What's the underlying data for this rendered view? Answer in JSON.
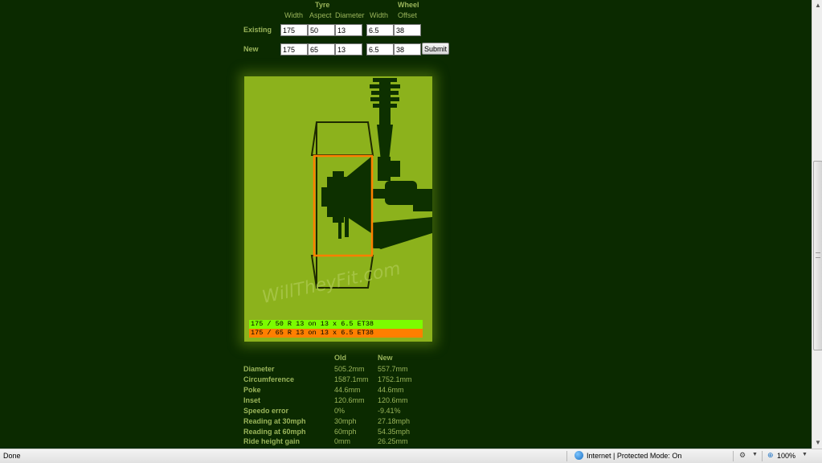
{
  "form": {
    "header_tyre": "Tyre",
    "header_wheel": "Wheel",
    "col_width": "Width",
    "col_aspect": "Aspect",
    "col_diameter": "Diameter",
    "col_wheel_width": "Width",
    "col_offset": "Offset",
    "existing_label": "Existing",
    "new_label": "New",
    "existing": {
      "width": "175",
      "aspect": "50",
      "diameter": "13",
      "wheel_width": "6.5",
      "offset": "38"
    },
    "new": {
      "width": "175",
      "aspect": "65",
      "diameter": "13",
      "wheel_width": "6.5",
      "offset": "38"
    },
    "submit_label": "Submit"
  },
  "diagram": {
    "watermark": "WillTheyFit.com",
    "existing_line": "175 / 50 R 13 on 13 x 6.5 ET38",
    "new_line": "175 / 65 R 13 on 13 x 6.5 ET38",
    "colors": {
      "existing": "#7cfc00",
      "new": "#ff7f00",
      "panel": "#8cb21c",
      "suspension": "#0d3000"
    }
  },
  "results": {
    "col_old": "Old",
    "col_new": "New",
    "rows": [
      {
        "label": "Diameter",
        "old": "505.2mm",
        "new": "557.7mm"
      },
      {
        "label": "Circumference",
        "old": "1587.1mm",
        "new": "1752.1mm"
      },
      {
        "label": "Poke",
        "old": "44.6mm",
        "new": "44.6mm"
      },
      {
        "label": "Inset",
        "old": "120.6mm",
        "new": "120.6mm"
      },
      {
        "label": "Speedo error",
        "old": "0%",
        "new": "-9.41%"
      },
      {
        "label": "Reading at 30mph",
        "old": "30mph",
        "new": "27.18mph"
      },
      {
        "label": "Reading at 60mph",
        "old": "60mph",
        "new": "54.35mph"
      },
      {
        "label": "Ride height gain",
        "old": "0mm",
        "new": "26.25mm"
      }
    ]
  },
  "statusbar": {
    "status_text": "Done",
    "zone_text": "Internet | Protected Mode: On",
    "zoom_text": "100%"
  }
}
